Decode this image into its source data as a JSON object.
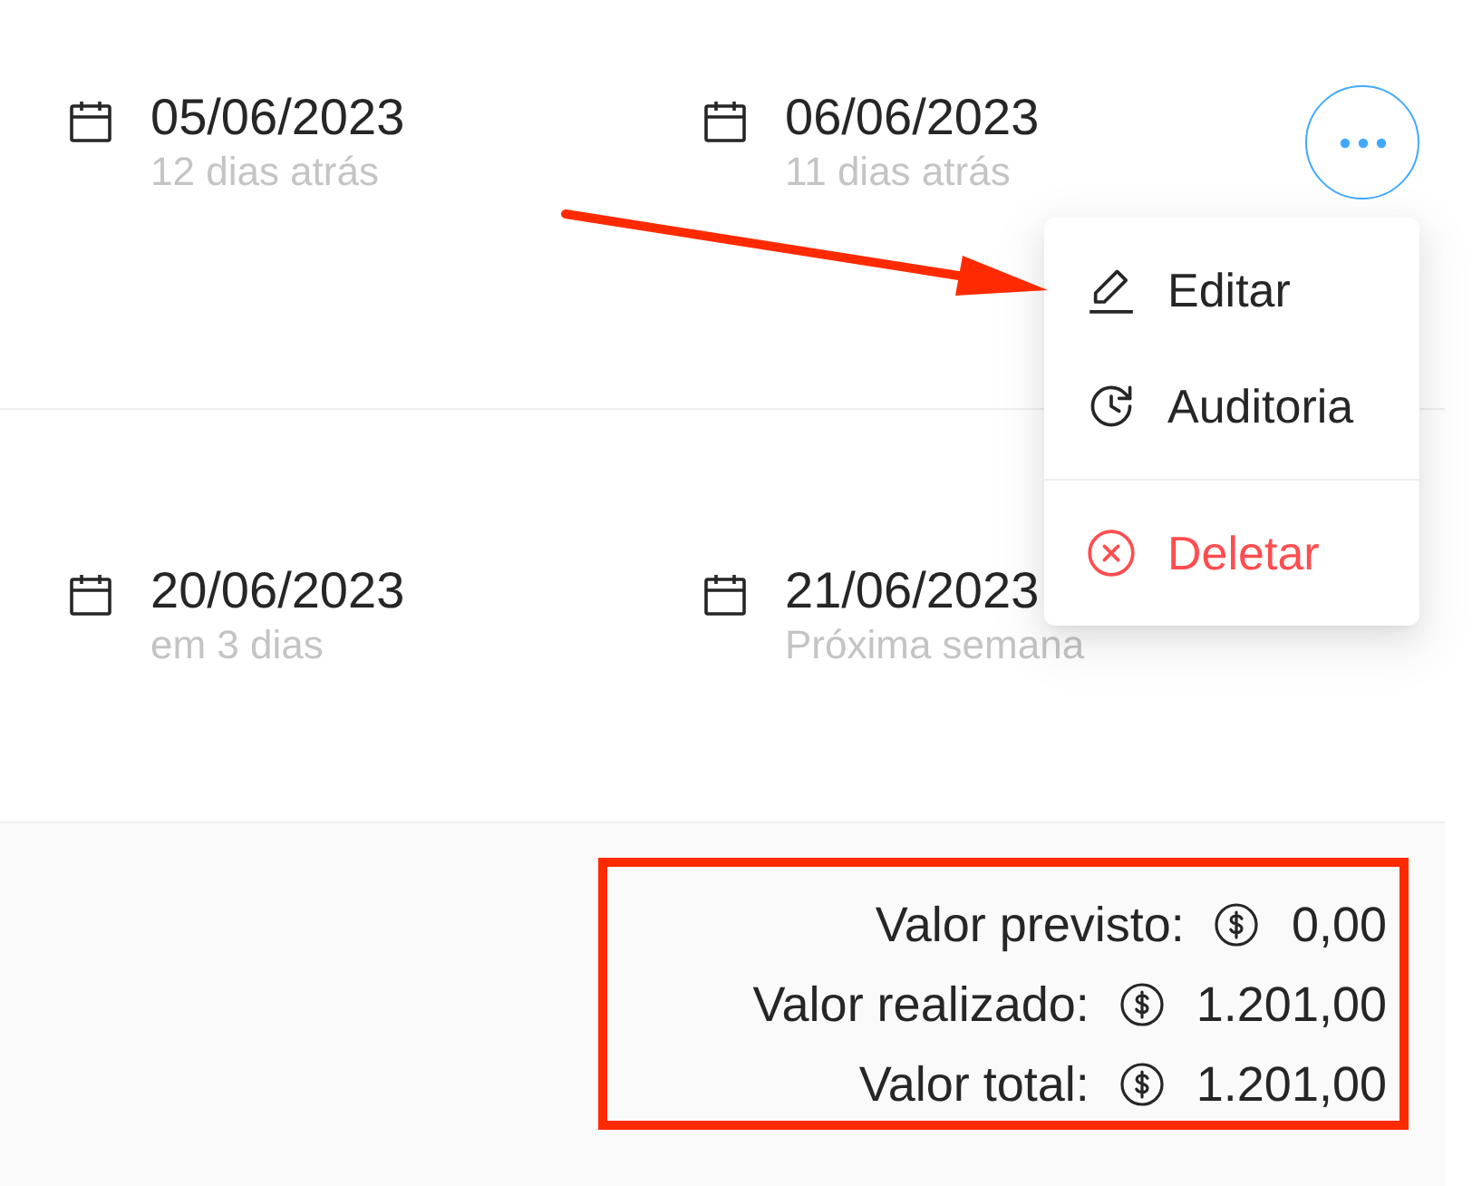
{
  "rows": [
    {
      "dates": [
        {
          "date": "05/06/2023",
          "relative": "12 dias atrás"
        },
        {
          "date": "06/06/2023",
          "relative": "11 dias atrás"
        }
      ],
      "more_button": {
        "active": true
      }
    },
    {
      "dates": [
        {
          "date": "20/06/2023",
          "relative": "em 3 dias"
        },
        {
          "date": "21/06/2023",
          "relative": "Próxima semana"
        }
      ]
    }
  ],
  "menu": {
    "items": [
      {
        "kind": "edit",
        "label": "Editar",
        "danger": false,
        "separated": false
      },
      {
        "kind": "audit",
        "label": "Auditoria",
        "danger": false,
        "separated": false
      },
      {
        "kind": "delete",
        "label": "Deletar",
        "danger": true,
        "separated": true
      }
    ]
  },
  "totals": [
    {
      "label": "Valor previsto:",
      "value": "0,00"
    },
    {
      "label": "Valor realizado:",
      "value": "1.201,00"
    },
    {
      "label": "Valor total:",
      "value": "1.201,00"
    }
  ]
}
